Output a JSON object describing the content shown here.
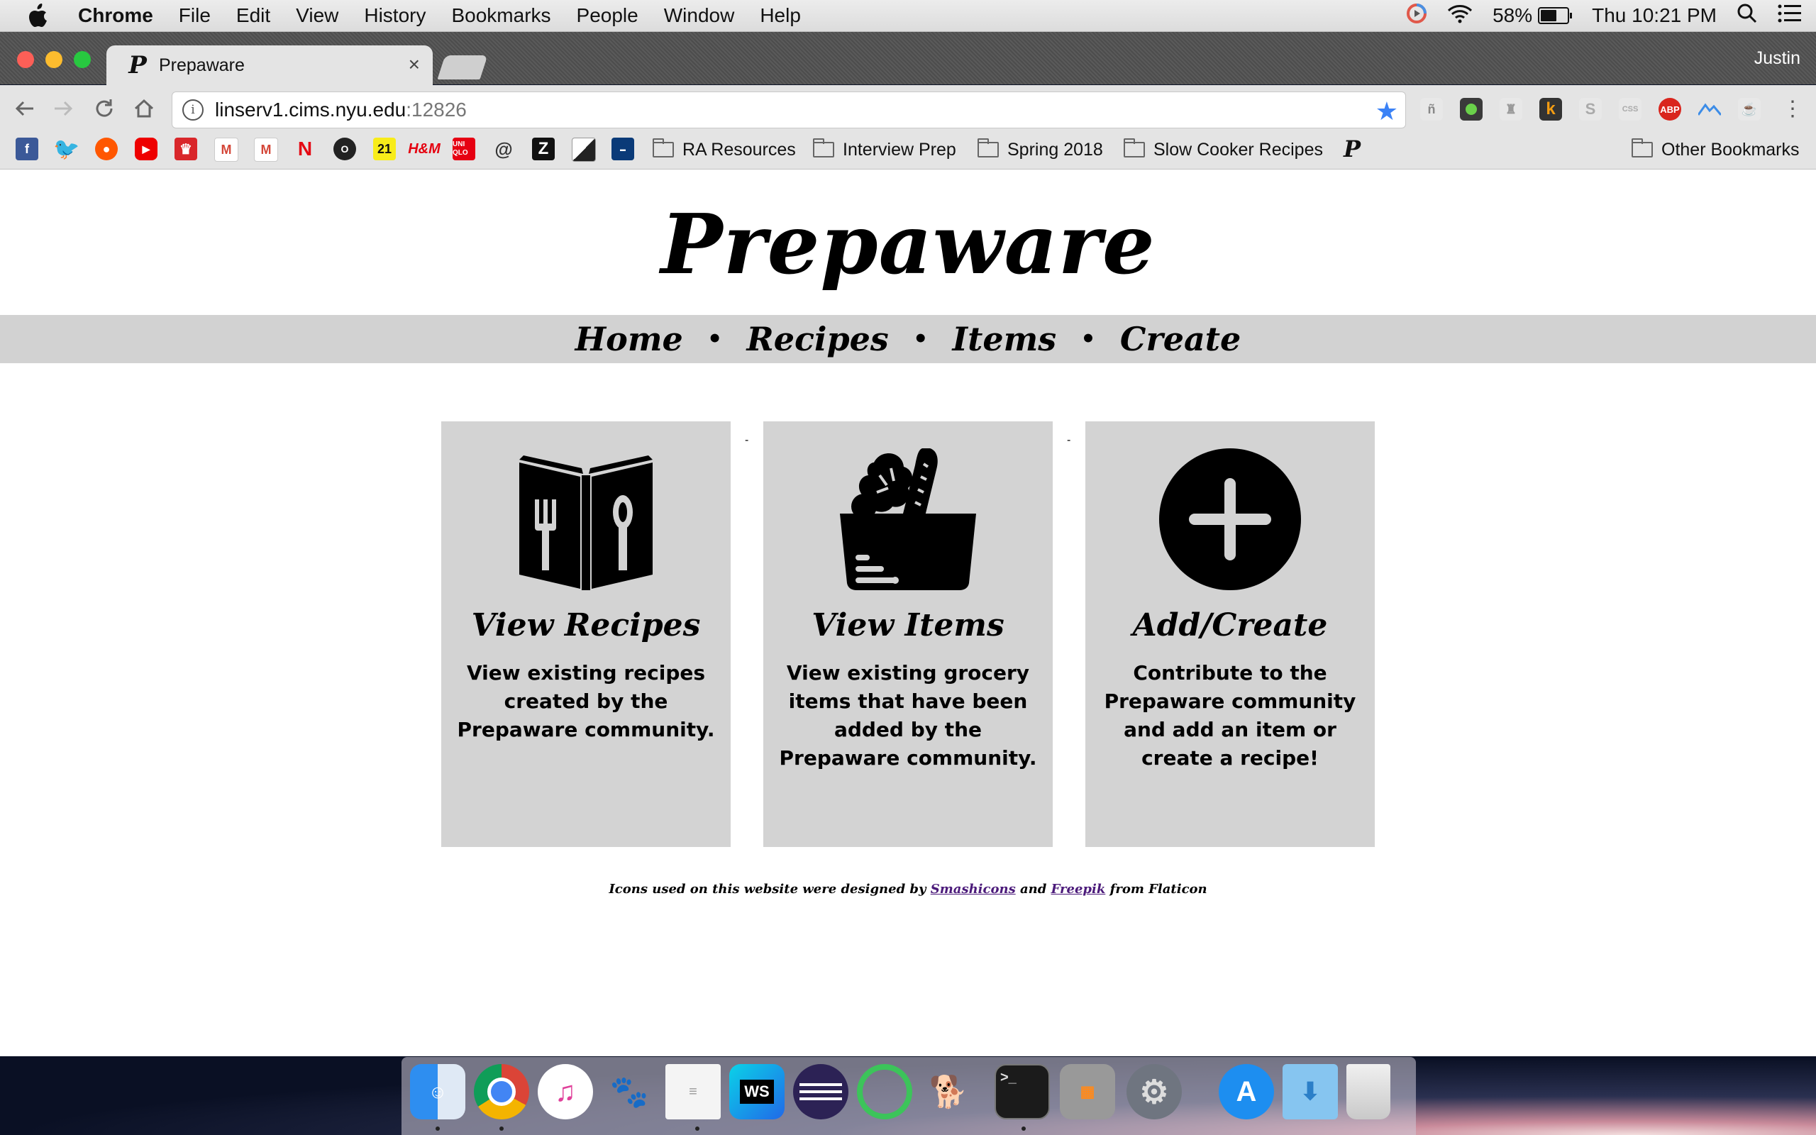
{
  "menubar": {
    "app": "Chrome",
    "items": [
      "File",
      "Edit",
      "View",
      "History",
      "Bookmarks",
      "People",
      "Window",
      "Help"
    ],
    "battery": "58%",
    "clock": "Thu 10:21 PM"
  },
  "browser": {
    "tab_title": "Prepaware",
    "tab_favicon": "P",
    "tab_close": "×",
    "profile": "Justin",
    "url_host": "linserv1.cims.nyu.edu",
    "url_port": ":12826",
    "bookmark_folders": [
      "RA Resources",
      "Interview Prep",
      "Spring 2018",
      "Slow Cooker Recipes"
    ],
    "other_bookmarks": "Other Bookmarks"
  },
  "site": {
    "title": "Prepaware",
    "nav": [
      "Home",
      "Recipes",
      "Items",
      "Create"
    ],
    "nav_separator": "•",
    "cards": [
      {
        "icon": "recipe-book-icon",
        "title": "View Recipes",
        "desc": "View existing recipes created by the Prepaware community."
      },
      {
        "icon": "grocery-bag-icon",
        "title": "View Items",
        "desc": "View existing grocery items that have been added by the Prepaware community."
      },
      {
        "icon": "add-circle-icon",
        "title": "Add/Create",
        "desc": "Contribute to the Prepaware community and add an item or create a recipe!"
      }
    ],
    "card_gap_marker": "-",
    "credits": {
      "prefix": "Icons used on this website were designed by ",
      "link1": "Smashicons",
      "middle": " and ",
      "link2": "Freepik",
      "suffix": " from Flaticon"
    }
  }
}
